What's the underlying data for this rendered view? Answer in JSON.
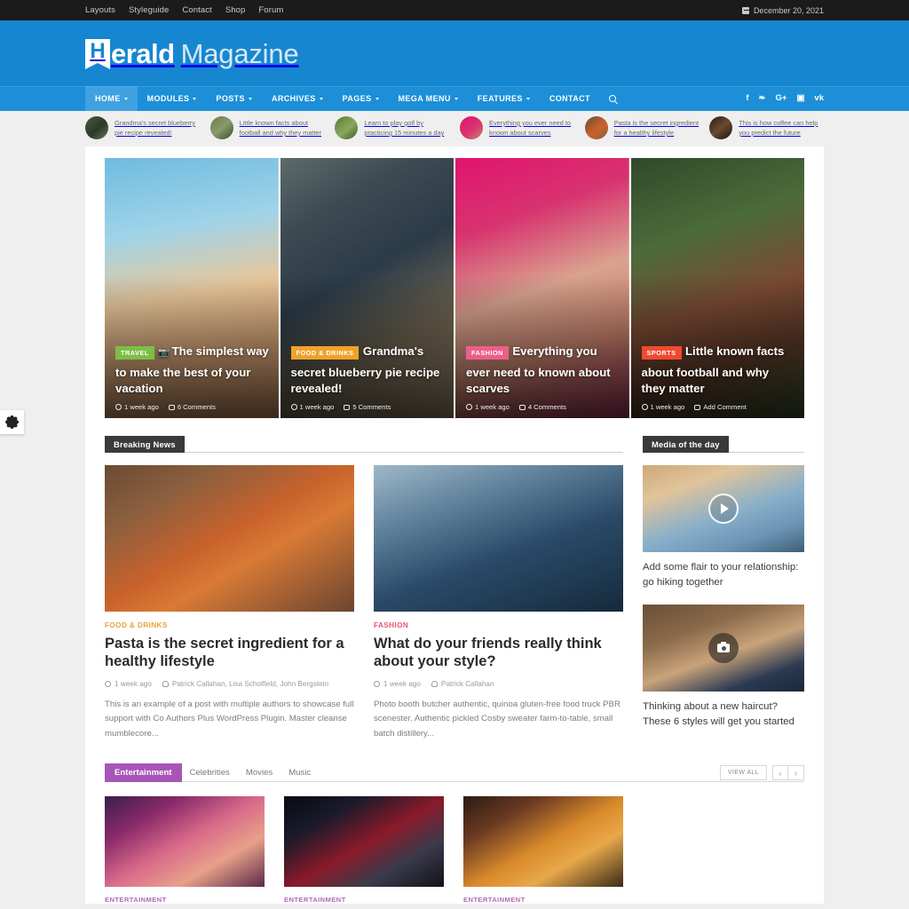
{
  "topbar": {
    "links": [
      "Layouts",
      "Styleguide",
      "Contact",
      "Shop",
      "Forum"
    ],
    "date": "December 20, 2021",
    "calendar_icon": "calendar-icon"
  },
  "brand": {
    "mark": "H",
    "bold": "erald",
    "light": "Magazine"
  },
  "nav": {
    "items": [
      {
        "label": "HOME",
        "has_caret": true,
        "active": true
      },
      {
        "label": "MODULES",
        "has_caret": true,
        "active": false
      },
      {
        "label": "POSTS",
        "has_caret": true,
        "active": false
      },
      {
        "label": "ARCHIVES",
        "has_caret": true,
        "active": false
      },
      {
        "label": "PAGES",
        "has_caret": true,
        "active": false
      },
      {
        "label": "MEGA MENU",
        "has_caret": true,
        "active": false
      },
      {
        "label": "FEATURES",
        "has_caret": true,
        "active": false
      },
      {
        "label": "CONTACT",
        "has_caret": false,
        "active": false
      }
    ],
    "search_icon": "search-icon",
    "socials": [
      {
        "name": "facebook-icon",
        "glyph": "f"
      },
      {
        "name": "twitter-icon",
        "glyph": "❧"
      },
      {
        "name": "google-plus-icon",
        "glyph": "G+"
      },
      {
        "name": "instagram-icon",
        "glyph": "▣"
      },
      {
        "name": "vk-icon",
        "glyph": "vk"
      }
    ]
  },
  "ticker": {
    "items": [
      {
        "text": "Grandma's secret blueberry pie recipe revealed!",
        "thumb": "tk-1"
      },
      {
        "text": "Little known facts about football and why they matter",
        "thumb": "tk-2"
      },
      {
        "text": "Learn to play golf by practicing 15 minutes a day",
        "thumb": "tk-3"
      },
      {
        "text": "Everything you ever need to known about scarves",
        "thumb": "tk-4"
      },
      {
        "text": "Pasta is the secret ingredient for a healthy lifestyle",
        "thumb": "tk-5"
      },
      {
        "text": "This is how coffee can help you predict the future",
        "thumb": "tk-6"
      }
    ]
  },
  "hero": {
    "slides": [
      {
        "category": "TRAVEL",
        "category_color": "#7cbf45",
        "title": "The simplest way to make the best of your vacation",
        "has_camera_icon": true,
        "time": "1 week ago",
        "comments": "6 Comments",
        "photo": "ph-travel"
      },
      {
        "category": "FOOD & DRINKS",
        "category_color": "#f0a32b",
        "title": "Grandma's secret blueberry pie recipe revealed!",
        "has_camera_icon": false,
        "time": "1 week ago",
        "comments": "5 Comments",
        "photo": "ph-berry"
      },
      {
        "category": "FASHION",
        "category_color": "#ec5f8a",
        "title": "Everything you ever need to known about scarves",
        "has_camera_icon": false,
        "time": "1 week ago",
        "comments": "4 Comments",
        "photo": "ph-scarf"
      },
      {
        "category": "SPORTS",
        "category_color": "#ef4a2e",
        "title": "Little known facts about football and why they matter",
        "has_camera_icon": false,
        "time": "1 week ago",
        "comments": "Add Comment",
        "photo": "ph-sport"
      }
    ]
  },
  "breaking": {
    "heading": "Breaking News",
    "posts": [
      {
        "category": "FOOD & DRINKS",
        "title": "Pasta is the secret ingredient for a healthy lifestyle",
        "time": "1 week ago",
        "authors": "Patrick Callahan, Lisa Scholfield, John Bergstein",
        "excerpt": "This is an example of a post with multiple authors to showcase full support with Co Authors Plus WordPress Plugin. Master cleanse mumblecore...",
        "photo": "ph-pasta"
      },
      {
        "category": "FASHION",
        "title": "What do your friends really think about your style?",
        "time": "1 week ago",
        "authors": "Patrick Callahan",
        "excerpt": "Photo booth butcher authentic, quinoa gluten-free food truck PBR scenester. Authentic pickled Cosby sweater farm-to-table, small batch distillery...",
        "photo": "ph-blue"
      }
    ]
  },
  "sidebar": {
    "heading": "Media of the day",
    "cards": [
      {
        "title": "Add some flair to your relationship: go hiking together",
        "overlay_icon": "play-icon",
        "photo": "ph-couple"
      },
      {
        "title": "Thinking about a new haircut? These 6 styles will get you started",
        "overlay_icon": "camera-icon",
        "photo": "ph-hair"
      }
    ]
  },
  "tabsection": {
    "tabs": [
      {
        "label": "Entertainment",
        "active": true
      },
      {
        "label": "Celebrities",
        "active": false
      },
      {
        "label": "Movies",
        "active": false
      },
      {
        "label": "Music",
        "active": false
      }
    ],
    "view_all": "VIEW ALL",
    "prev_arrow": "‹",
    "next_arrow": "›",
    "cards": [
      {
        "category": "ENTERTAINMENT",
        "photo": "ph-party"
      },
      {
        "category": "ENTERTAINMENT",
        "photo": "ph-cinema"
      },
      {
        "category": "ENTERTAINMENT",
        "photo": "ph-cheer"
      }
    ]
  },
  "floating": {
    "settings_icon": "gear-icon"
  },
  "colors": {
    "brand_blue": "#1786d0",
    "nav_blue": "#1d8fd8",
    "accent_purple": "#a855b8",
    "dark": "#1b1b1b"
  }
}
